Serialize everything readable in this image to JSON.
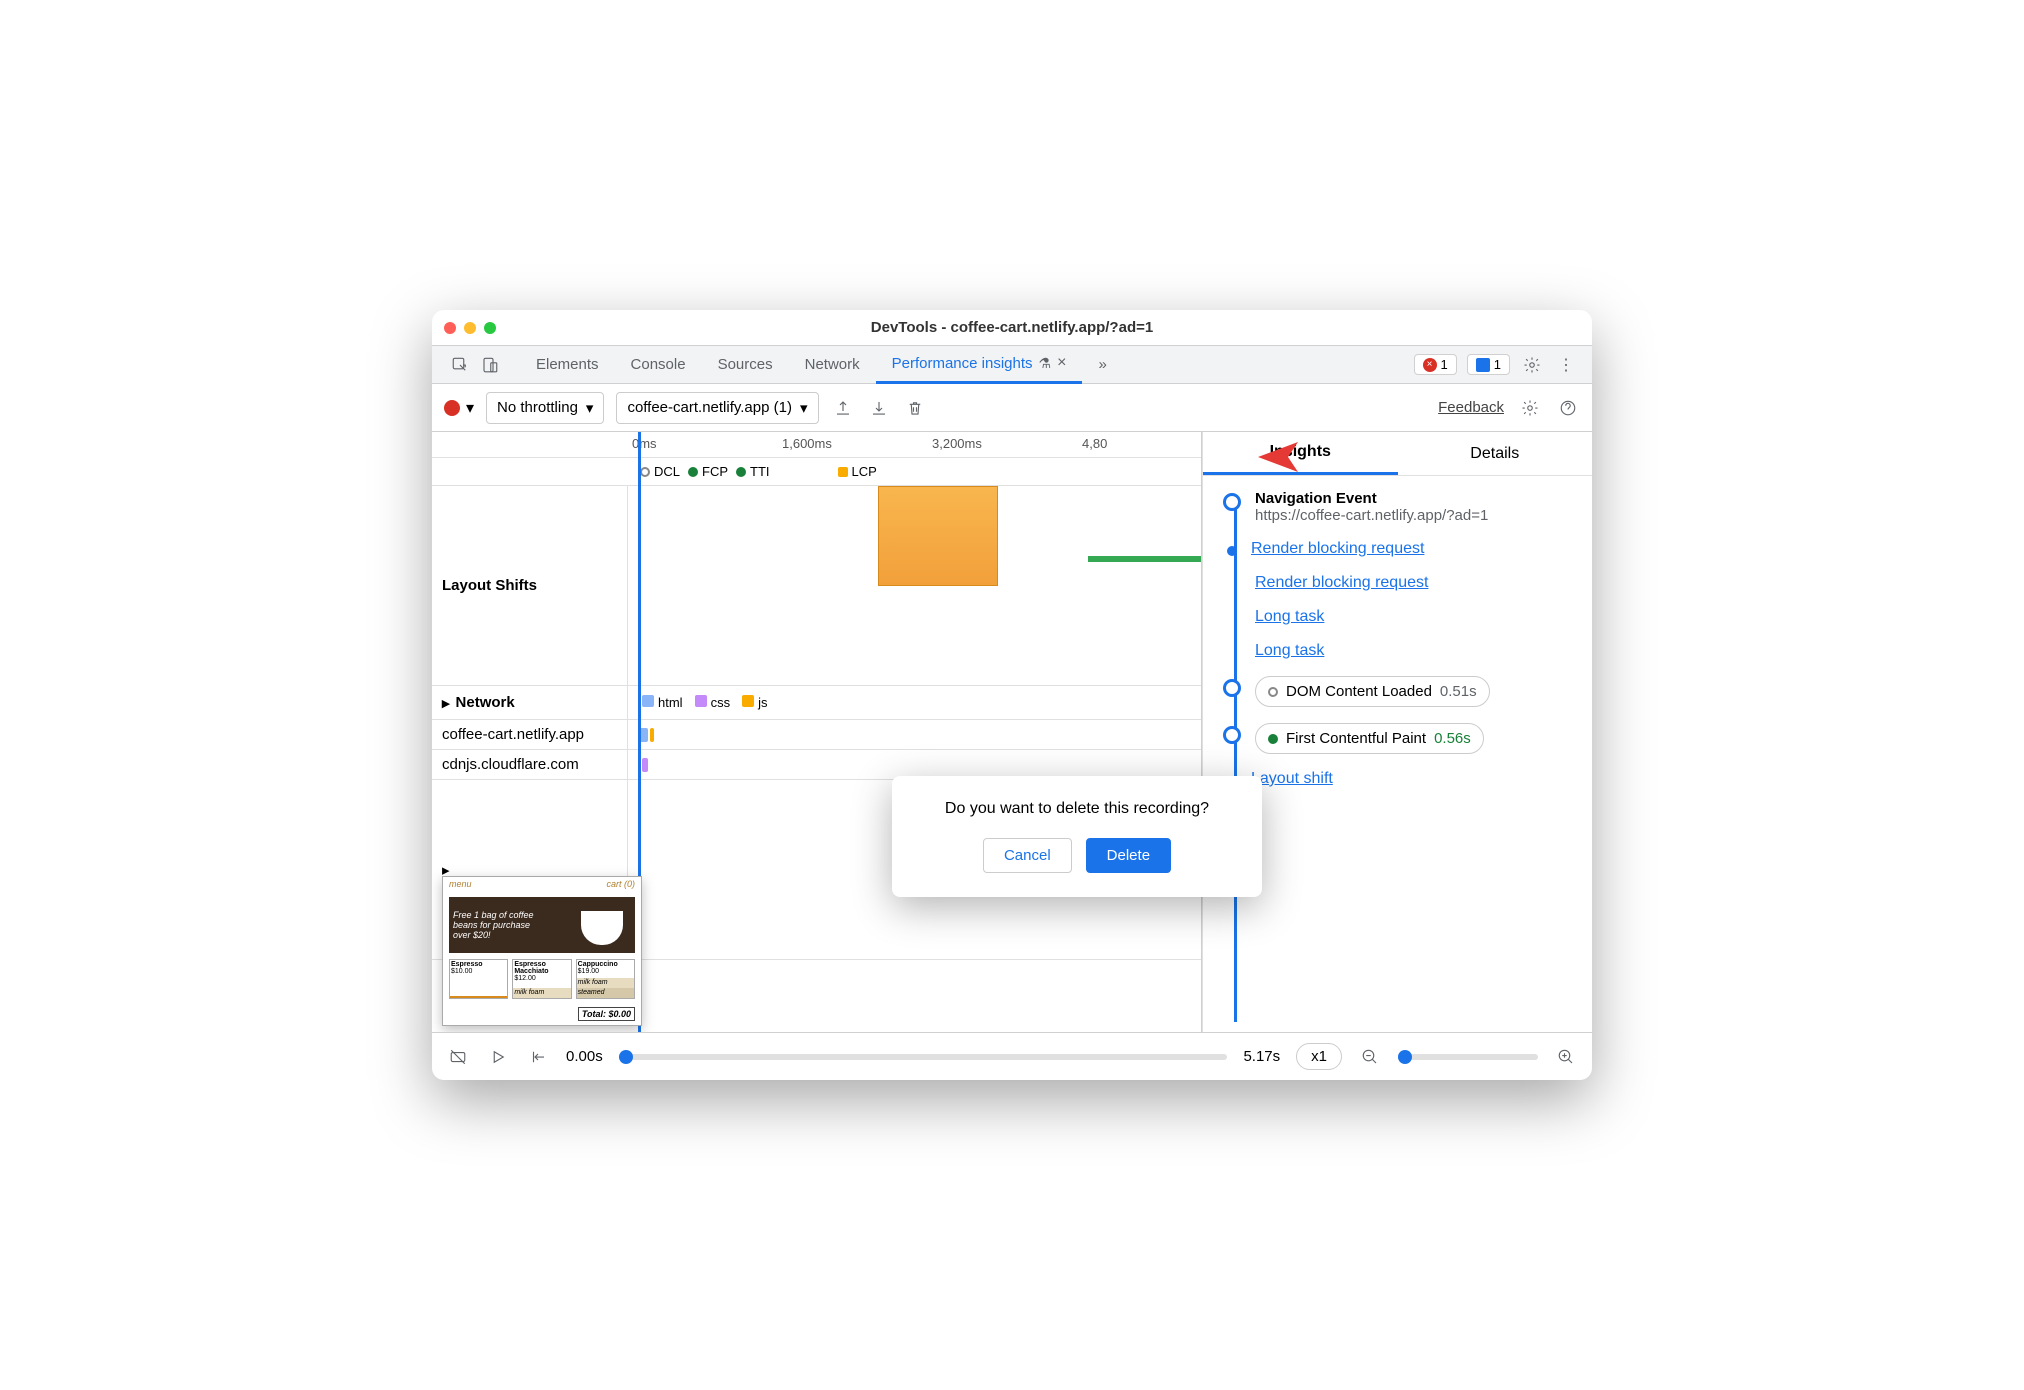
{
  "titlebar": {
    "title": "DevTools - coffee-cart.netlify.app/?ad=1"
  },
  "tabs": {
    "elements": "Elements",
    "console": "Console",
    "sources": "Sources",
    "network": "Network",
    "performance_insights": "Performance insights"
  },
  "badges": {
    "error_count": "1",
    "issue_count": "1"
  },
  "toolbar": {
    "throttling": "No throttling",
    "recording": "coffee-cart.netlify.app (1)",
    "feedback": "Feedback"
  },
  "timeline": {
    "ticks": [
      "0ms",
      "1,600ms",
      "3,200ms",
      "4,80"
    ],
    "markers": {
      "dcl": "DCL",
      "fcp": "FCP",
      "tti": "TTI",
      "lcp": "LCP"
    },
    "layout_shifts_label": "Layout Shifts",
    "network_label": "Network",
    "network_types": {
      "html": "html",
      "css": "css",
      "js": "js"
    },
    "network_hosts": [
      "coffee-cart.netlify.app",
      "cdnjs.cloudflare.com"
    ],
    "thumb": {
      "menu": "menu",
      "cart": "cart (0)",
      "promo": "Free 1 bag of coffee beans for purchase over $20!",
      "p1_name": "Espresso",
      "p1_price": "$10.00",
      "p2_name": "Espresso Macchiato",
      "p2_price": "$12.00",
      "p2_foam": "milk foam",
      "p3_name": "Cappuccino",
      "p3_price": "$19.00",
      "p3_foam": "milk foam",
      "p3_steamed": "steamed",
      "total": "Total: $0.00"
    }
  },
  "side": {
    "tab_insights": "Insights",
    "tab_details": "Details",
    "nav_title": "Navigation Event",
    "nav_url": "https://coffee-cart.netlify.app/?ad=1",
    "rbr": "Render blocking request",
    "long_task": "Long task",
    "dcl_label": "DOM Content Loaded",
    "dcl_time": "0.51s",
    "fcp_label": "First Contentful Paint",
    "fcp_time": "0.56s",
    "layout_shift": "Layout shift"
  },
  "modal": {
    "message": "Do you want to delete this recording?",
    "cancel": "Cancel",
    "delete": "Delete"
  },
  "footer": {
    "start": "0.00s",
    "end": "5.17s",
    "speed": "x1"
  }
}
